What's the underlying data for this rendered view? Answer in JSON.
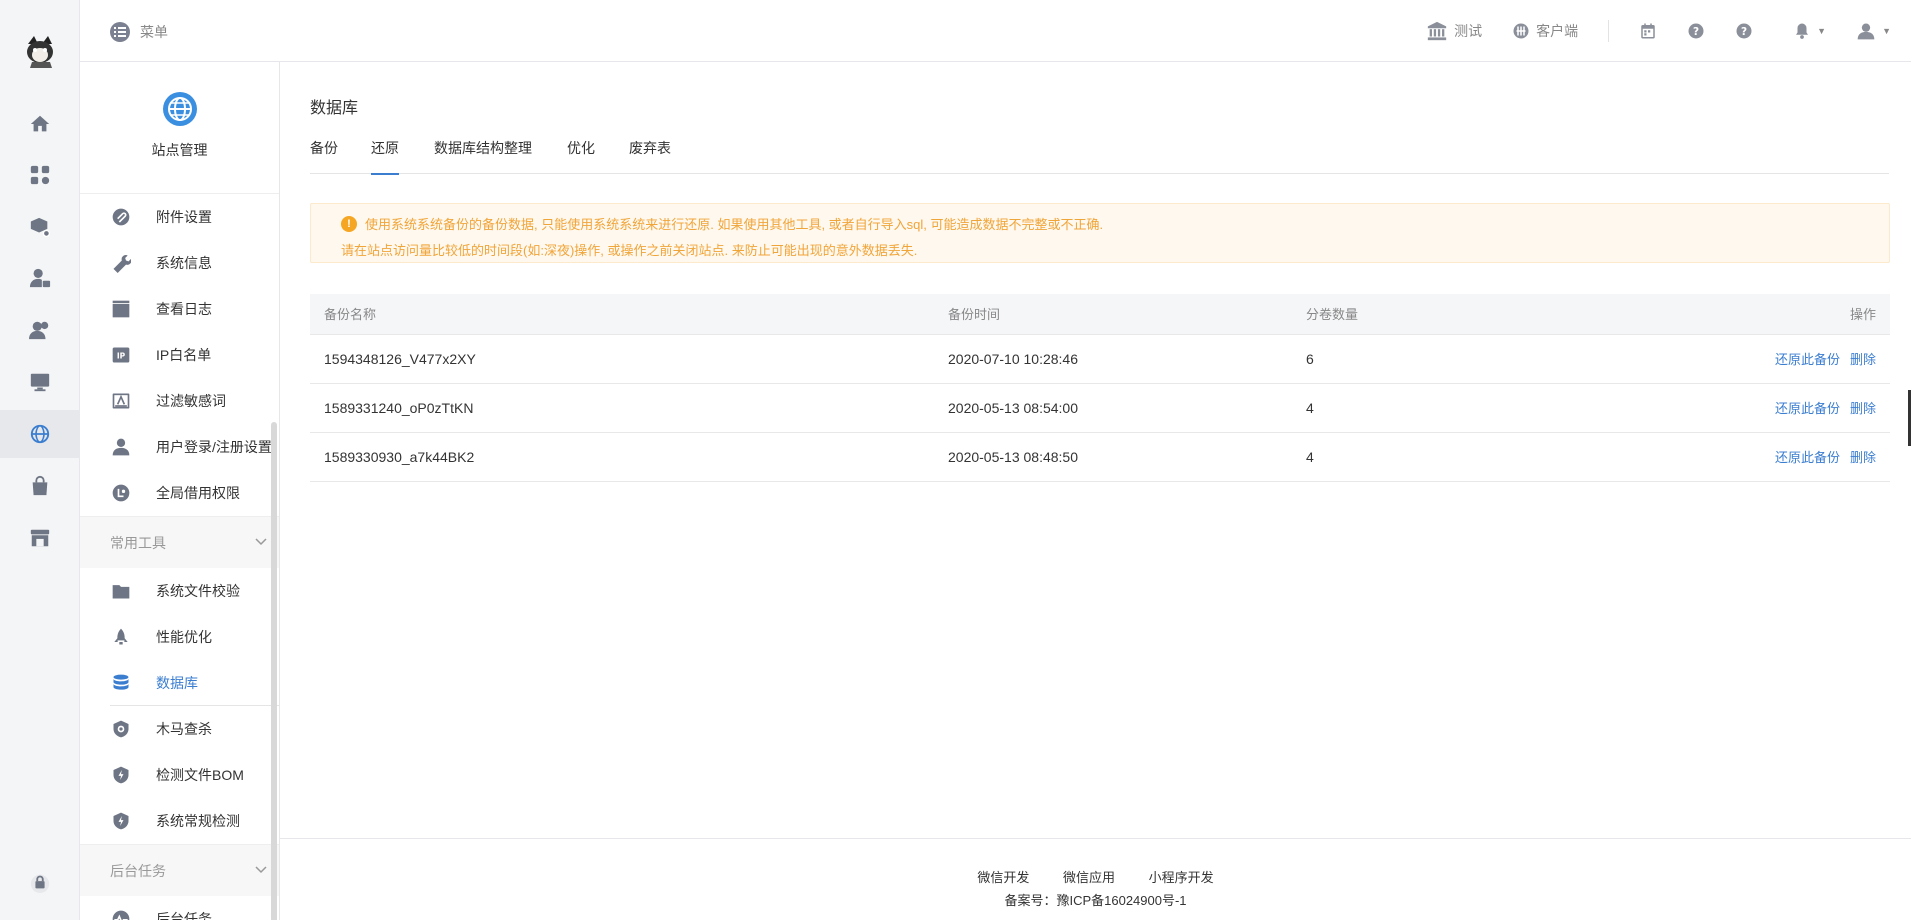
{
  "topbar": {
    "menu_label": "菜单",
    "items": [
      {
        "label": "测试",
        "icon": "bank-icon"
      },
      {
        "label": "客户端",
        "icon": "client-icon"
      }
    ]
  },
  "rail": {
    "items": [
      "home-icon",
      "apps-icon",
      "box-settings-icon",
      "user-lock-icon",
      "users-icon",
      "monitor-icon",
      "globe-icon",
      "bag-icon",
      "store-icon"
    ],
    "active": "globe-icon"
  },
  "sidebar": {
    "title": "站点管理",
    "items": [
      {
        "label": "附件设置",
        "icon": "attachment-icon"
      },
      {
        "label": "系统信息",
        "icon": "tools-icon"
      },
      {
        "label": "查看日志",
        "icon": "clapper-icon"
      },
      {
        "label": "IP白名单",
        "icon": "ip-icon"
      },
      {
        "label": "过滤敏感词",
        "icon": "filter-icon"
      },
      {
        "label": "用户登录/注册设置",
        "icon": "user-icon"
      },
      {
        "label": "全局借用权限",
        "icon": "permission-icon"
      }
    ],
    "group1": "常用工具",
    "tools": [
      {
        "label": "系统文件校验",
        "icon": "folder-icon"
      },
      {
        "label": "性能优化",
        "icon": "rocket-icon"
      },
      {
        "label": "数据库",
        "icon": "database-icon",
        "active": true
      },
      {
        "label": "木马查杀",
        "icon": "shield-scan-icon"
      },
      {
        "label": "检测文件BOM",
        "icon": "shield-bolt-icon"
      },
      {
        "label": "系统常规检测",
        "icon": "shield-bolt-icon"
      }
    ],
    "group2": "后台任务",
    "tasks": [
      {
        "label": "后台任务",
        "icon": "pulse-icon"
      }
    ]
  },
  "main": {
    "title": "数据库",
    "tabs": [
      "备份",
      "还原",
      "数据库结构整理",
      "优化",
      "废弃表"
    ],
    "active_tab": "还原",
    "alert": {
      "line1": "使用系统系统备份的备份数据, 只能使用系统系统来进行还原. 如果使用其他工具, 或者自行导入sql, 可能造成数据不完整或不正确.",
      "line2": "请在站点访问量比较低的时间段(如:深夜)操作, 或操作之前关闭站点. 来防止可能出现的意外数据丢失."
    },
    "table": {
      "headers": [
        "备份名称",
        "备份时间",
        "分卷数量",
        "操作"
      ],
      "rows": [
        {
          "name": "1594348126_V477x2XY",
          "time": "2020-07-10 10:28:46",
          "count": "6",
          "restore": "还原此备份",
          "delete": "删除"
        },
        {
          "name": "1589331240_oP0zTtKN",
          "time": "2020-05-13 08:54:00",
          "count": "4",
          "restore": "还原此备份",
          "delete": "删除"
        },
        {
          "name": "1589330930_a7k44BK2",
          "time": "2020-05-13 08:48:50",
          "count": "4",
          "restore": "还原此备份",
          "delete": "删除"
        }
      ]
    }
  },
  "footer": {
    "links": [
      "微信开发",
      "微信应用",
      "小程序开发"
    ],
    "icp": "备案号：豫ICP备16024900号-1"
  },
  "colors": {
    "accent": "#3b7ed0",
    "warning": "#f0a539"
  }
}
